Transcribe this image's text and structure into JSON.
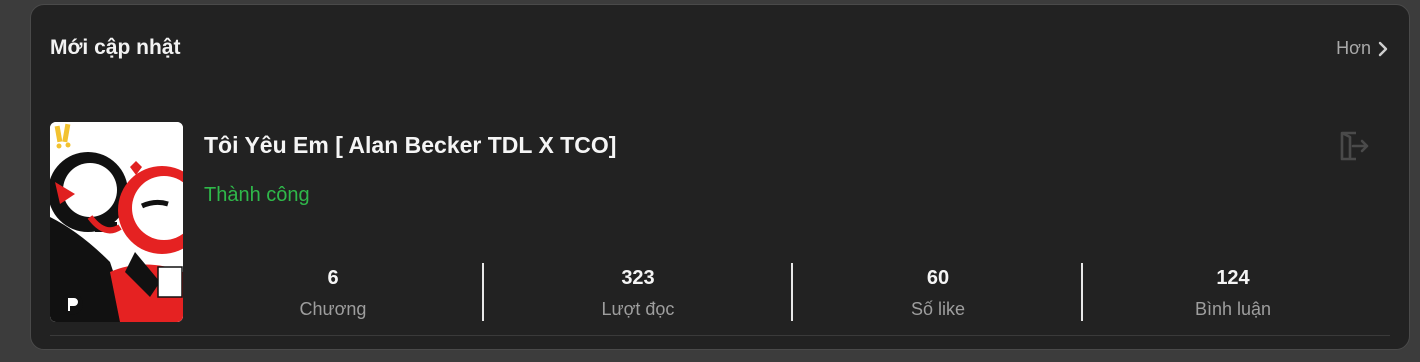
{
  "section": {
    "title": "Mới cập nhật",
    "more_label": "Hơn",
    "more_icon": "chevron-right-icon"
  },
  "story": {
    "title": "Tôi Yêu Em [ Alan Becker TDL X TCO]",
    "status": "Thành công",
    "status_color": "#2fb84a",
    "action_icon": "exit-icon",
    "stats": [
      {
        "value": "6",
        "label": "Chương"
      },
      {
        "value": "323",
        "label": "Lượt đọc"
      },
      {
        "value": "60",
        "label": "Số like"
      },
      {
        "value": "124",
        "label": "Bình luận"
      }
    ]
  }
}
